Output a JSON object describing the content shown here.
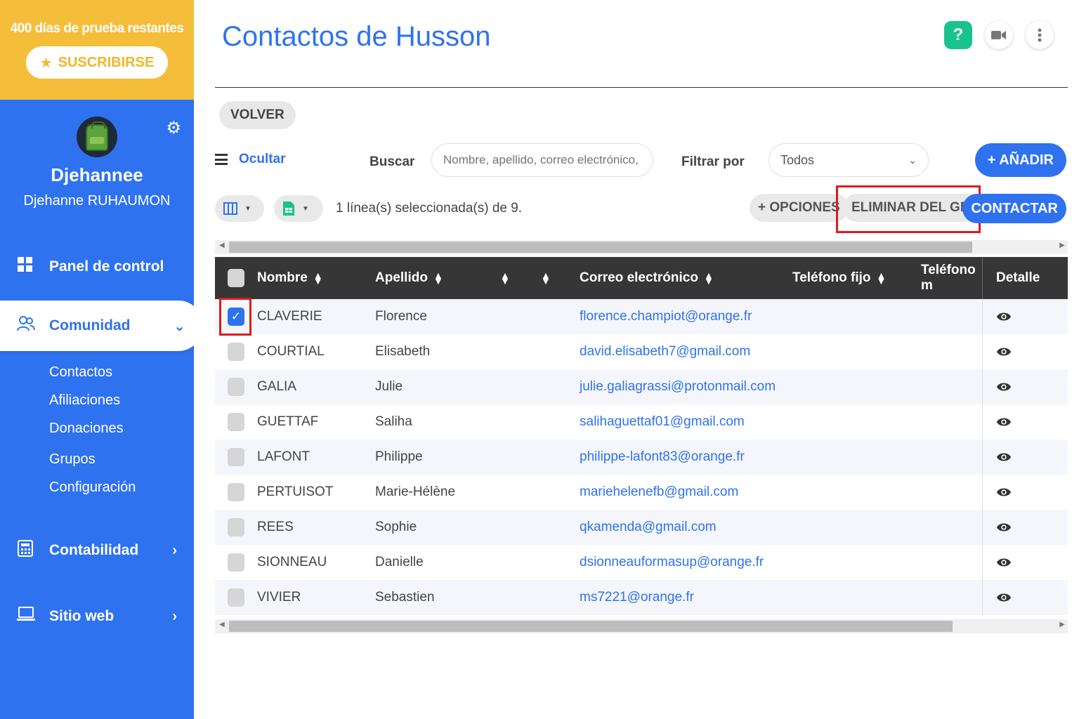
{
  "trial": {
    "text": "400 días de prueba restantes",
    "subscribe_label": "SUSCRIBIRSE"
  },
  "profile": {
    "name": "Djehannee",
    "full_name": "Djehanne RUHAUMON"
  },
  "nav": {
    "dashboard": "Panel de control",
    "community": "Comunidad",
    "community_sub": [
      "Contactos",
      "Afiliaciones",
      "Donaciones",
      "Grupos",
      "Configuración"
    ],
    "accounting": "Contabilidad",
    "website": "Sitio web"
  },
  "header": {
    "title": "Contactos de Husson"
  },
  "back_label": "VOLVER",
  "toolbar": {
    "hide_label": "Ocultar",
    "search_label": "Buscar",
    "search_placeholder": "Nombre, apellido, correo electrónico, ...",
    "filter_label": "Filtrar por",
    "filter_value": "Todos",
    "add_label": "+ AÑADIR"
  },
  "actions": {
    "selection_text": "1 línea(s) seleccionada(s) de 9.",
    "options_label": "+ OPCIONES",
    "remove_label": "ELIMINAR DEL GRUPO",
    "contact_label": "CONTACTAR"
  },
  "table": {
    "headers": {
      "first_name": "Nombre",
      "last_name": "Apellido",
      "email": "Correo electrónico",
      "phone": "Teléfono fijo",
      "mobile": "Teléfono m",
      "detail": "Detalle"
    },
    "rows": [
      {
        "checked": true,
        "name": "CLAVERIE",
        "surname": "Florence",
        "email": "florence.champiot@orange.fr"
      },
      {
        "checked": false,
        "name": "COURTIAL",
        "surname": "Elisabeth",
        "email": "david.elisabeth7@gmail.com"
      },
      {
        "checked": false,
        "name": "GALIA",
        "surname": "Julie",
        "email": "julie.galiagrassi@protonmail.com"
      },
      {
        "checked": false,
        "name": "GUETTAF",
        "surname": "Saliha",
        "email": "salihaguettaf01@gmail.com"
      },
      {
        "checked": false,
        "name": "LAFONT",
        "surname": "Philippe",
        "email": "philippe-lafont83@orange.fr"
      },
      {
        "checked": false,
        "name": "PERTUISOT",
        "surname": "Marie-Hélène",
        "email": "mariehelenefb@gmail.com"
      },
      {
        "checked": false,
        "name": "REES",
        "surname": "Sophie",
        "email": "qkamenda@gmail.com"
      },
      {
        "checked": false,
        "name": "SIONNEAU",
        "surname": "Danielle",
        "email": "dsionneauformasup@orange.fr"
      },
      {
        "checked": false,
        "name": "VIVIER",
        "surname": "Sebastien",
        "email": "ms7221@orange.fr"
      }
    ]
  },
  "colors": {
    "primary": "#2f72f0",
    "trial": "#f5be3a",
    "highlight": "#e01a1a",
    "header_bg": "#363636",
    "help": "#19c38e"
  }
}
